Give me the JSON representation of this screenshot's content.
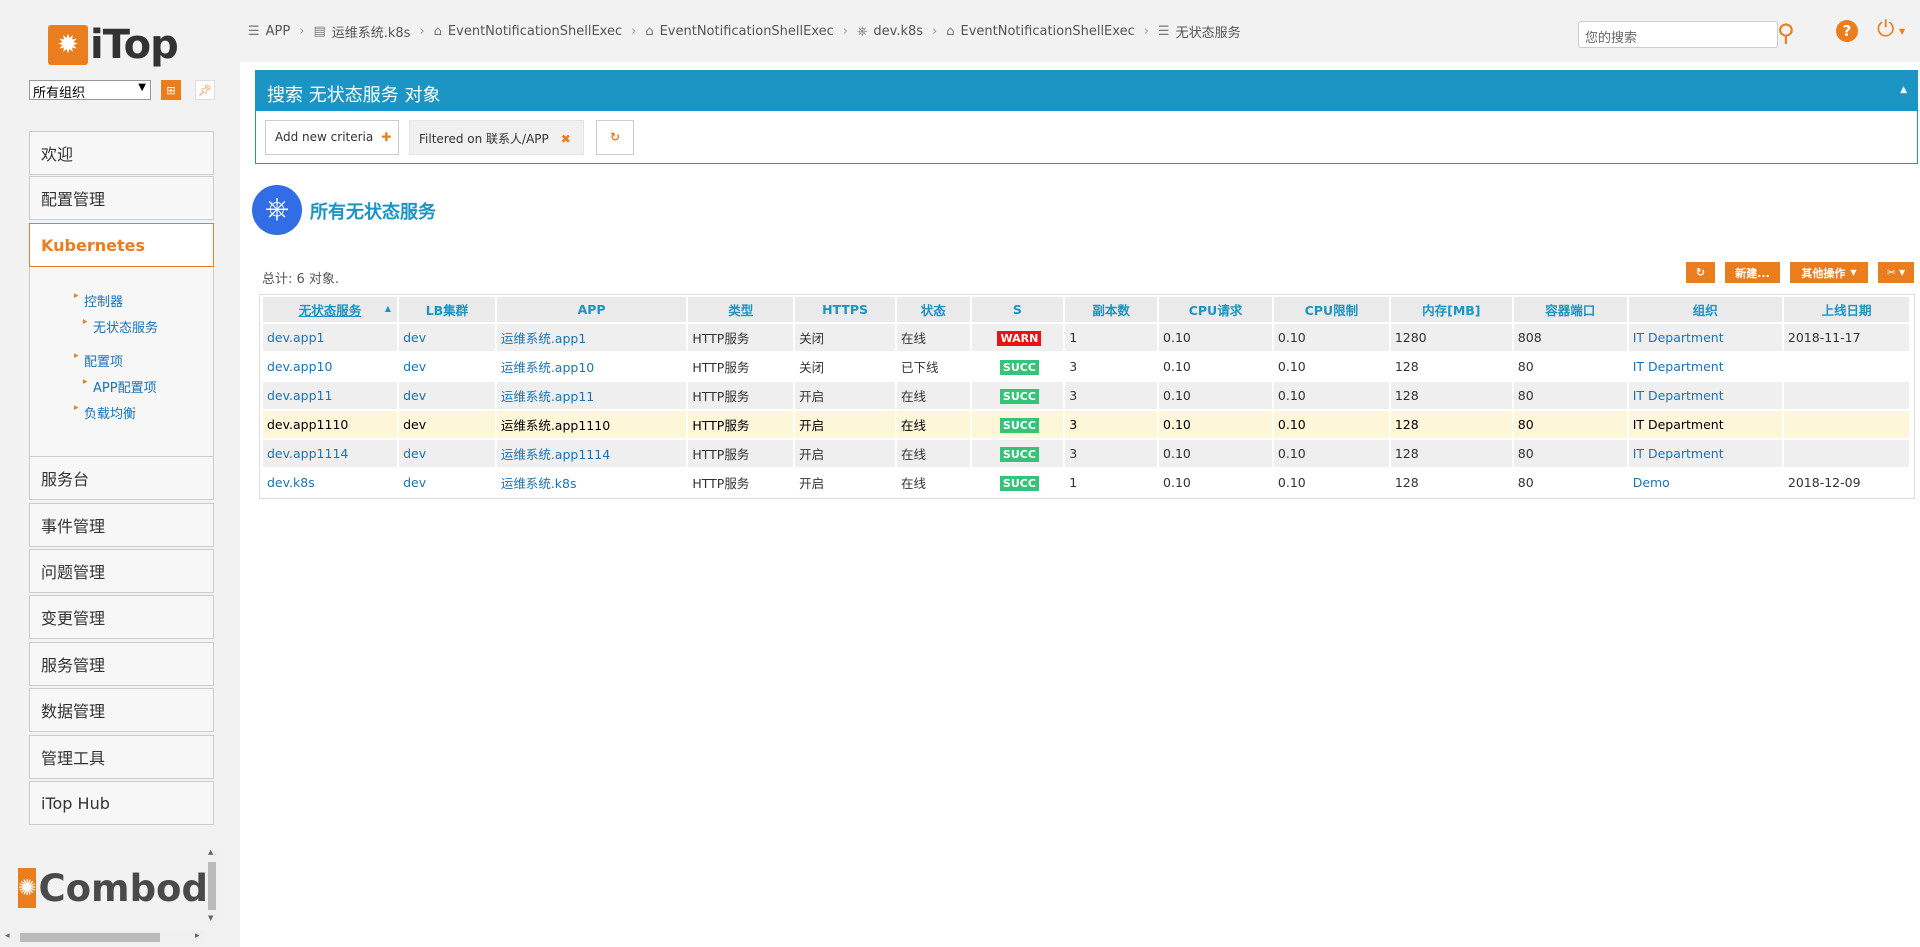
{
  "app": {
    "logo_text": "iTop",
    "footer_logo_text": "Combodo"
  },
  "org_selector": {
    "value": "所有组织"
  },
  "menu": {
    "items": [
      {
        "label": "欢迎"
      },
      {
        "label": "配置管理"
      },
      {
        "label": "Kubernetes"
      },
      {
        "label": "服务台"
      },
      {
        "label": "事件管理"
      },
      {
        "label": "问题管理"
      },
      {
        "label": "变更管理"
      },
      {
        "label": "服务管理"
      },
      {
        "label": "数据管理"
      },
      {
        "label": "管理工具"
      },
      {
        "label": "iTop Hub"
      }
    ],
    "k8s_sub": [
      {
        "label": "控制器"
      },
      {
        "label": "无状态服务"
      },
      {
        "label": "配置项"
      },
      {
        "label": "APP配置项"
      },
      {
        "label": "负载均衡"
      }
    ]
  },
  "breadcrumb": [
    {
      "label": "APP",
      "icon": "list-icon"
    },
    {
      "label": "运维系统.k8s",
      "icon": "server-icon"
    },
    {
      "label": "EventNotificationShellExec",
      "icon": "bell-icon"
    },
    {
      "label": "EventNotificationShellExec",
      "icon": "bell-icon"
    },
    {
      "label": "dev.k8s",
      "icon": "kubernetes-icon"
    },
    {
      "label": "EventNotificationShellExec",
      "icon": "bell-icon"
    },
    {
      "label": "无状态服务",
      "icon": "list-icon"
    }
  ],
  "search": {
    "placeholder": "您的搜索"
  },
  "search_panel": {
    "title": "搜索 无状态服务 对象",
    "add_criteria": "Add new criteria",
    "filter_tag": "Filtered on 联系人/APP"
  },
  "results": {
    "title": "所有无状态服务",
    "total": "总计: 6 对象.",
    "actions": {
      "new": "新建...",
      "other": "其他操作"
    },
    "columns": [
      "无状态服务",
      "LB集群",
      "APP",
      "类型",
      "HTTPS",
      "状态",
      "S",
      "副本数",
      "CPU请求",
      "CPU限制",
      "内存[MB]",
      "容器端口",
      "组织",
      "上线日期"
    ],
    "rows": [
      {
        "name": "dev.app1",
        "lb": "dev",
        "app": "运维系统.app1",
        "type": "HTTP服务",
        "https": "关闭",
        "status": "在线",
        "s": "WARN",
        "replicas": "1",
        "cpu_req": "0.10",
        "cpu_lim": "0.10",
        "mem": "1280",
        "port": "808",
        "org": "IT Department",
        "date": "2018-11-17"
      },
      {
        "name": "dev.app10",
        "lb": "dev",
        "app": "运维系统.app10",
        "type": "HTTP服务",
        "https": "关闭",
        "status": "已下线",
        "s": "SUCC",
        "replicas": "3",
        "cpu_req": "0.10",
        "cpu_lim": "0.10",
        "mem": "128",
        "port": "80",
        "org": "IT Department",
        "date": ""
      },
      {
        "name": "dev.app11",
        "lb": "dev",
        "app": "运维系统.app11",
        "type": "HTTP服务",
        "https": "开启",
        "status": "在线",
        "s": "SUCC",
        "replicas": "3",
        "cpu_req": "0.10",
        "cpu_lim": "0.10",
        "mem": "128",
        "port": "80",
        "org": "IT Department",
        "date": ""
      },
      {
        "name": "dev.app1110",
        "lb": "dev",
        "app": "运维系统.app1110",
        "type": "HTTP服务",
        "https": "开启",
        "status": "在线",
        "s": "SUCC",
        "replicas": "3",
        "cpu_req": "0.10",
        "cpu_lim": "0.10",
        "mem": "128",
        "port": "80",
        "org": "IT Department",
        "date": ""
      },
      {
        "name": "dev.app1114",
        "lb": "dev",
        "app": "运维系统.app1114",
        "type": "HTTP服务",
        "https": "开启",
        "status": "在线",
        "s": "SUCC",
        "replicas": "3",
        "cpu_req": "0.10",
        "cpu_lim": "0.10",
        "mem": "128",
        "port": "80",
        "org": "IT Department",
        "date": ""
      },
      {
        "name": "dev.k8s",
        "lb": "dev",
        "app": "运维系统.k8s",
        "type": "HTTP服务",
        "https": "开启",
        "status": "在线",
        "s": "SUCC",
        "replicas": "1",
        "cpu_req": "0.10",
        "cpu_lim": "0.10",
        "mem": "128",
        "port": "80",
        "org": "Demo",
        "date": "2018-12-09"
      }
    ]
  },
  "colors": {
    "accent": "#ea7d1e",
    "primary": "#1c94c4",
    "link": "#1a73b5",
    "warn": "#ee1111",
    "succ": "#34c379"
  }
}
